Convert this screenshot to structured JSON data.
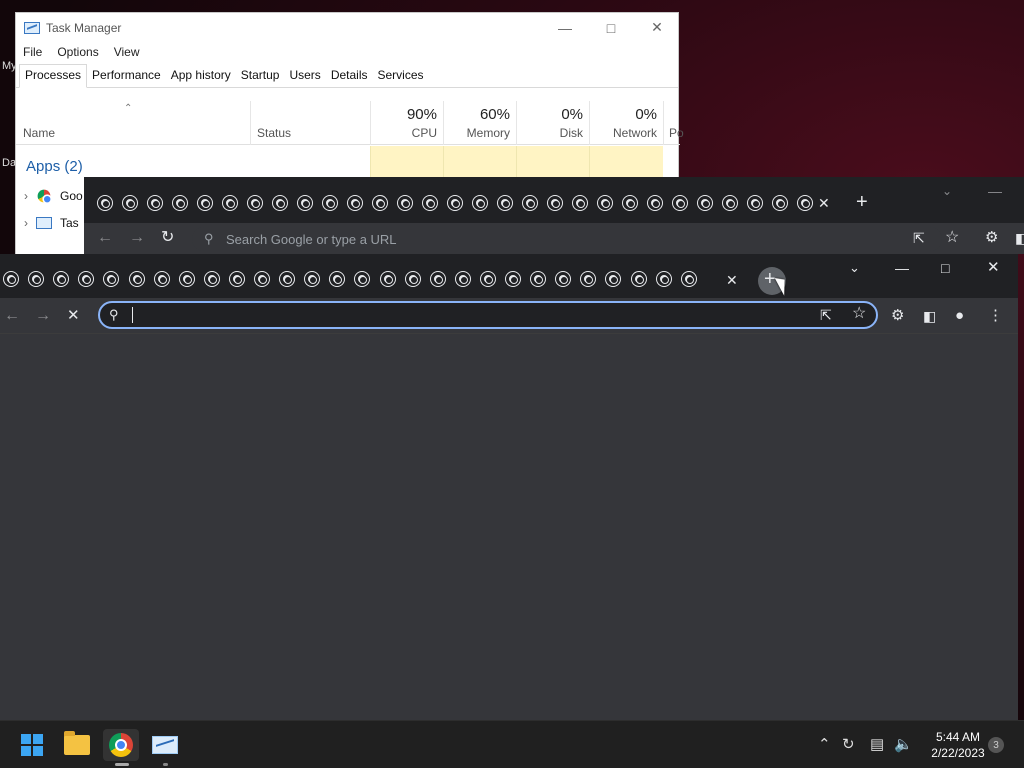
{
  "desktop": {
    "label_a": "My",
    "label_b": "Da"
  },
  "task_manager": {
    "title": "Task Manager",
    "menu": [
      "File",
      "Options",
      "View"
    ],
    "tabs": [
      "Processes",
      "Performance",
      "App history",
      "Startup",
      "Users",
      "Details",
      "Services"
    ],
    "columns": {
      "name": "Name",
      "status": "Status",
      "cpu": {
        "pct": "90%",
        "label": "CPU"
      },
      "memory": {
        "pct": "60%",
        "label": "Memory"
      },
      "disk": {
        "pct": "0%",
        "label": "Disk"
      },
      "network": {
        "pct": "0%",
        "label": "Network"
      },
      "power": "Po"
    },
    "apps_header": "Apps (2)",
    "rows": [
      "Goo",
      "Tas"
    ]
  },
  "chrome_back": {
    "omnibox_placeholder": "Search Google or type a URL",
    "tab_count": 29
  },
  "chrome_front": {
    "omnibox_value": "",
    "tab_count": 28
  },
  "taskbar": {
    "time": "5:44 AM",
    "date": "2/22/2023",
    "notification_count": "3"
  },
  "colors": {
    "accent": "#8ab4f8",
    "chrome_dark": "#202124",
    "chrome_toolbar": "#35363a"
  }
}
